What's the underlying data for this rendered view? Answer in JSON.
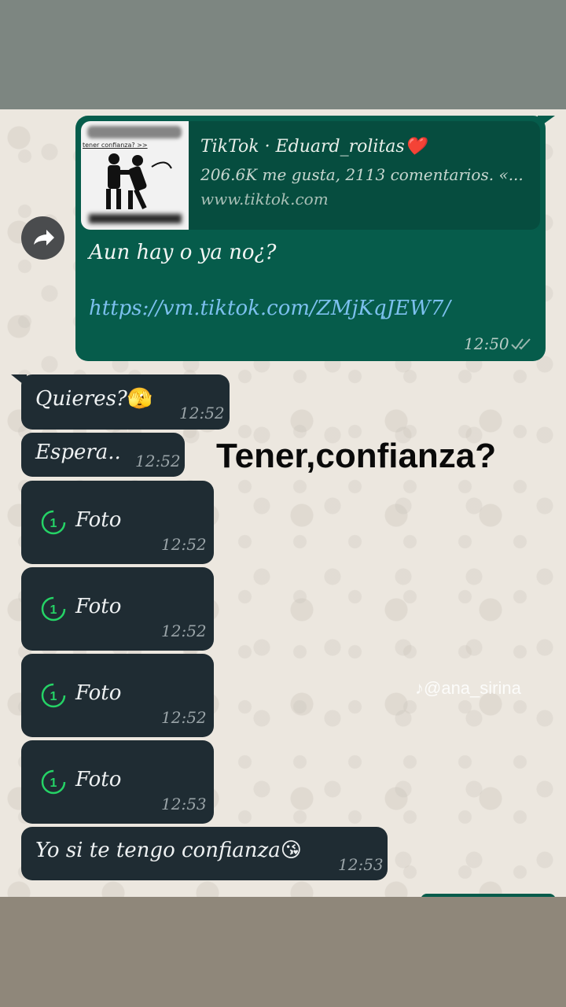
{
  "link_preview": {
    "thumbnail_caption": "tener confianza? >>",
    "title": "TikTok · Eduard_rolitas❤️",
    "description": "206.6K me gusta, 2113 comentarios. «...",
    "site": "www.tiktok.com"
  },
  "outgoing_message": {
    "text": "Aun hay o ya no¿?",
    "link": "https://vm.tiktok.com/ZMjKqJEW7/",
    "time": "12:50",
    "status_icon": "double-check-icon"
  },
  "forward_icon": "forward-arrow-icon",
  "incoming_messages": [
    {
      "text": "Quieres?",
      "emoji": "🫣",
      "time": "12:52"
    },
    {
      "text": "Espera..",
      "time": "12:52"
    },
    {
      "text": "Foto",
      "icon": "view-once-icon",
      "time": "12:52"
    },
    {
      "text": "Foto",
      "icon": "view-once-icon",
      "time": "12:52"
    },
    {
      "text": "Foto",
      "icon": "view-once-icon",
      "time": "12:52"
    },
    {
      "text": "Foto",
      "icon": "view-once-icon",
      "time": "12:53"
    },
    {
      "text": "Yo si te tengo confianza",
      "emoji": "😘",
      "time": "12:53"
    }
  ],
  "overlay_caption": "Tener,confianza?",
  "watermark": "@ana_sirina",
  "colors": {
    "outgoing_bubble": "#065c4b",
    "incoming_bubble": "#1f2c33",
    "link": "#7cc0ee",
    "view_once_icon": "#25d366"
  }
}
